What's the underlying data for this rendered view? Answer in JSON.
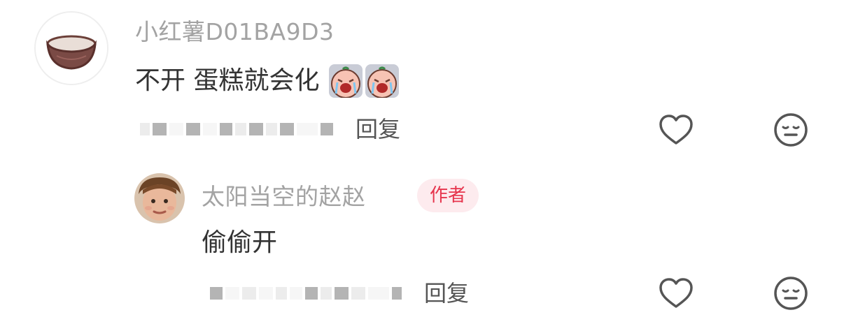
{
  "comments": [
    {
      "username": "小红薯D01BA9D3",
      "text": "不开 蛋糕就会化",
      "emojis": [
        "crying-face-emoji",
        "crying-face-emoji"
      ],
      "reply_label": "回复",
      "like_icon": "heart-icon",
      "dislike_icon": "neutral-face-icon",
      "avatar": "coconut-bowl-avatar"
    },
    {
      "username": "太阳当空的赵赵",
      "badge": "作者",
      "text": "偷偷开",
      "reply_label": "回复",
      "like_icon": "heart-icon",
      "dislike_icon": "neutral-face-icon",
      "avatar": "boy-face-avatar"
    }
  ],
  "colors": {
    "username": "#a3a3a3",
    "content": "#333333",
    "badge_text": "#e6354d",
    "badge_bg": "#fdebee",
    "icon_stroke": "#555555"
  }
}
